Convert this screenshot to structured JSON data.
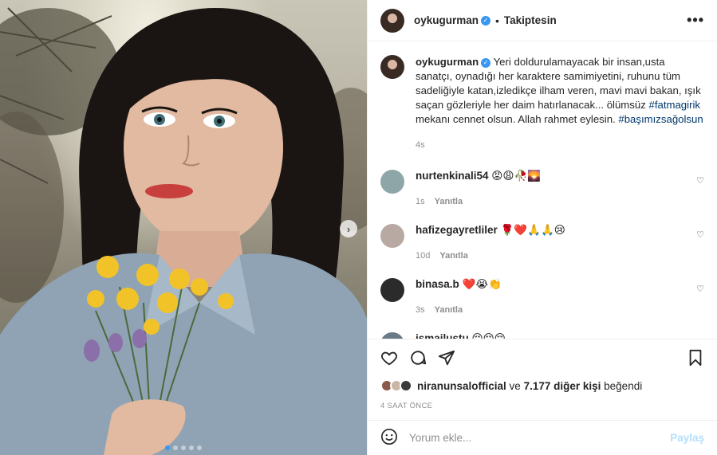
{
  "header": {
    "username": "oykugurman",
    "separator": "•",
    "follow_status": "Takiptesin",
    "more_glyph": "•••"
  },
  "caption": {
    "username": "oykugurman",
    "text": "Yeri doldurulamayacak bir insan,usta sanatçı, oynadığı her karaktere samimiyetini, ruhunu tüm sadeliğiyle katan,izledikçe ilham veren, mavi mavi bakan, ışık saçan gözleriyle her daim hatırlanacak... ölümsüz",
    "hashtag1": "#fatmagirik",
    "text2": "mekanı cennet olsun. Allah rahmet eylesin.",
    "hashtag2": "#başımızsağolsun",
    "time": "4s"
  },
  "comments": [
    {
      "username": "nurtenkinali54",
      "text": "😡😩🥀🌄",
      "time": "1s",
      "reply": "Yanıtla",
      "avatar_color": "#8fa6a8"
    },
    {
      "username": "hafizegayretliler",
      "text": "🌹❤️🙏🙏😢",
      "time": "10d",
      "reply": "Yanıtla",
      "avatar_color": "#b8aaa2"
    },
    {
      "username": "binasa.b",
      "text": "❤️😭👏",
      "time": "3s",
      "reply": "Yanıtla",
      "avatar_color": "#2b2b2b"
    },
    {
      "username": "ismailustu",
      "text": "😔😔😔",
      "time": "",
      "reply": "",
      "avatar_color": "#6c7a86"
    }
  ],
  "likes": {
    "user": "niranunsalofficial",
    "connector": "ve",
    "others": "7.177 diğer kişi",
    "suffix": "beğendi"
  },
  "timestamp": "4 SAAT ÖNCE",
  "comment_box": {
    "placeholder": "Yorum ekle...",
    "post_label": "Paylaş"
  },
  "colors": {
    "accent": "#3897f0",
    "hashtag": "#00376b",
    "muted": "#8e8e8e",
    "post_disabled": "#b2dffc"
  },
  "carousel": {
    "pages": 5,
    "active": 0,
    "next_glyph": "›"
  }
}
